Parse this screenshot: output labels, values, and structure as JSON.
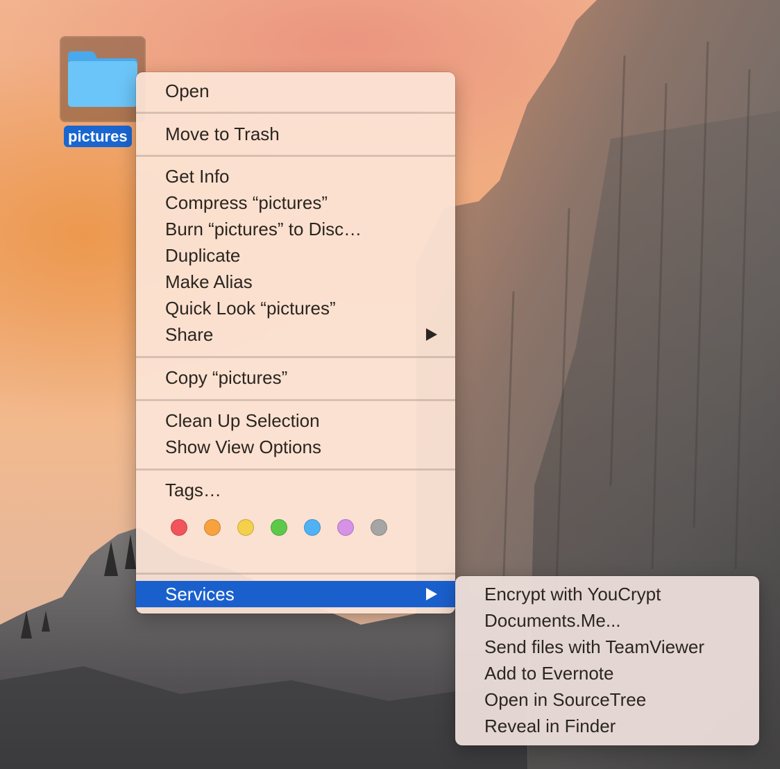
{
  "desktop": {
    "folder": {
      "name": "pictures",
      "icon": "folder-icon"
    }
  },
  "context_menu": {
    "groups": [
      {
        "items": [
          {
            "label": "Open"
          }
        ]
      },
      {
        "items": [
          {
            "label": "Move to Trash"
          }
        ]
      },
      {
        "items": [
          {
            "label": "Get Info"
          },
          {
            "label": "Compress “pictures”"
          },
          {
            "label": "Burn “pictures” to Disc…"
          },
          {
            "label": "Duplicate"
          },
          {
            "label": "Make Alias"
          },
          {
            "label": "Quick Look “pictures”"
          },
          {
            "label": "Share",
            "submenu": true
          }
        ]
      },
      {
        "items": [
          {
            "label": "Copy “pictures”"
          }
        ]
      },
      {
        "items": [
          {
            "label": "Clean Up Selection"
          },
          {
            "label": "Show View Options"
          }
        ]
      },
      {
        "items": [
          {
            "label": "Tags…"
          }
        ]
      },
      {
        "items": [
          {
            "label": "Services",
            "submenu": true,
            "highlighted": true
          }
        ]
      }
    ],
    "tag_colors": [
      {
        "name": "red",
        "color": "#f2545b"
      },
      {
        "name": "orange",
        "color": "#f7a23d"
      },
      {
        "name": "yellow",
        "color": "#f5d04b"
      },
      {
        "name": "green",
        "color": "#5dc94a"
      },
      {
        "name": "blue",
        "color": "#4fb2f5"
      },
      {
        "name": "purple",
        "color": "#d592e6"
      },
      {
        "name": "gray",
        "color": "#a5a5a5"
      }
    ]
  },
  "services_submenu": {
    "items": [
      {
        "label": "Encrypt with YouCrypt"
      },
      {
        "label": "Documents.Me..."
      },
      {
        "label": "Send files with TeamViewer"
      },
      {
        "label": "Add to Evernote"
      },
      {
        "label": "Open in SourceTree"
      },
      {
        "label": "Reveal in Finder"
      }
    ]
  },
  "colors": {
    "highlight": "#1a60cd",
    "selection_label": "#1a66d1",
    "folder_blue": "#5cc2f7"
  }
}
